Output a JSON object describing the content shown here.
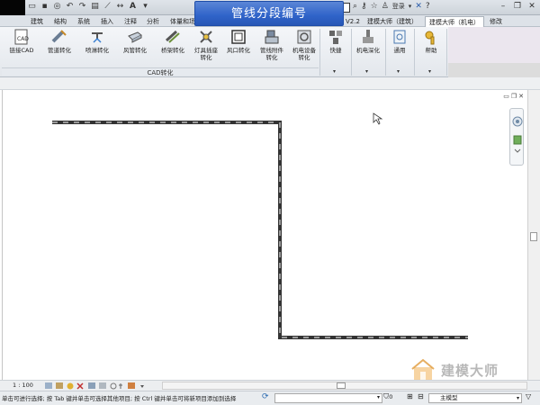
{
  "title_banner": "管线分段编号",
  "qat": {
    "login_label": "登录"
  },
  "tabs": [
    {
      "label": "建筑"
    },
    {
      "label": "结构"
    },
    {
      "label": "系统"
    },
    {
      "label": "插入"
    },
    {
      "label": "注释"
    },
    {
      "label": "分析"
    },
    {
      "label": "体量和场"
    },
    {
      "label": "V2.2"
    },
    {
      "label": "建模大师（建筑）"
    },
    {
      "label": "建模大师（机电）"
    },
    {
      "label": "修改"
    }
  ],
  "ribbon": {
    "cad_buttons": [
      {
        "label": "链接CAD",
        "icon": "cad-link-icon"
      },
      {
        "label": "管道转化",
        "icon": "pipe-convert-icon"
      },
      {
        "label": "喷淋转化",
        "icon": "sprinkler-convert-icon"
      },
      {
        "label": "风管转化",
        "icon": "duct-convert-icon"
      },
      {
        "label": "桥架转化",
        "icon": "tray-convert-icon"
      },
      {
        "label": "灯具插座转化",
        "icon": "lamp-convert-icon"
      },
      {
        "label": "风口转化",
        "icon": "vent-convert-icon"
      },
      {
        "label": "管线附件转化",
        "icon": "fitting-convert-icon"
      },
      {
        "label": "机电设备转化",
        "icon": "equipment-convert-icon"
      }
    ],
    "cad_group_label": "CAD转化",
    "right_buttons": [
      {
        "label": "快捷",
        "icon": "shortcut-icon"
      },
      {
        "label": "机电深化",
        "icon": "mep-deepen-icon"
      },
      {
        "label": "通用",
        "icon": "general-icon"
      },
      {
        "label": "帮助",
        "icon": "help-icon"
      }
    ]
  },
  "viewbar": {
    "scale": "1 : 100"
  },
  "status": {
    "hint": "单击可进行选择; 按 Tab 键并单击可选择其他项目; 按 Ctrl 键并单击可将新项目添加到选择",
    "filter_count": ":0",
    "model": "主模型"
  },
  "watermark": {
    "text": "建模大师"
  }
}
